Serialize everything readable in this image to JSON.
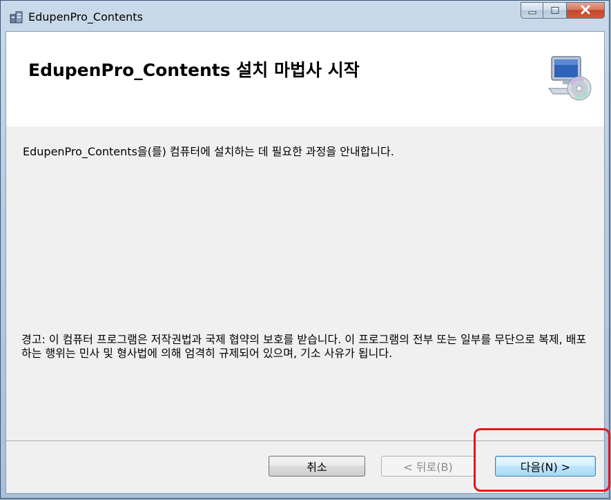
{
  "window": {
    "title": "EdupenPro_Contents"
  },
  "banner": {
    "title": "EdupenPro_Contents 설치 마법사 시작",
    "icon": "computer-install-disc-icon"
  },
  "body": {
    "intro": "EdupenPro_Contents을(를) 컴퓨터에 설치하는 데 필요한 과정을 안내합니다.",
    "warning": "경고: 이 컴퓨터 프로그램은 저작권법과 국제 협약의 보호를 받습니다. 이 프로그램의 전부 또는 일부를 무단으로 복제, 배포하는 행위는 민사 및 형사법에 의해 엄격히 규제되어 있으며, 기소 사유가 됩니다."
  },
  "buttons": {
    "cancel": "취소",
    "back": "< 뒤로(B)",
    "next": "다음(N) >"
  },
  "colors": {
    "highlight": "#e8141b",
    "close_button": "#c2452a"
  }
}
